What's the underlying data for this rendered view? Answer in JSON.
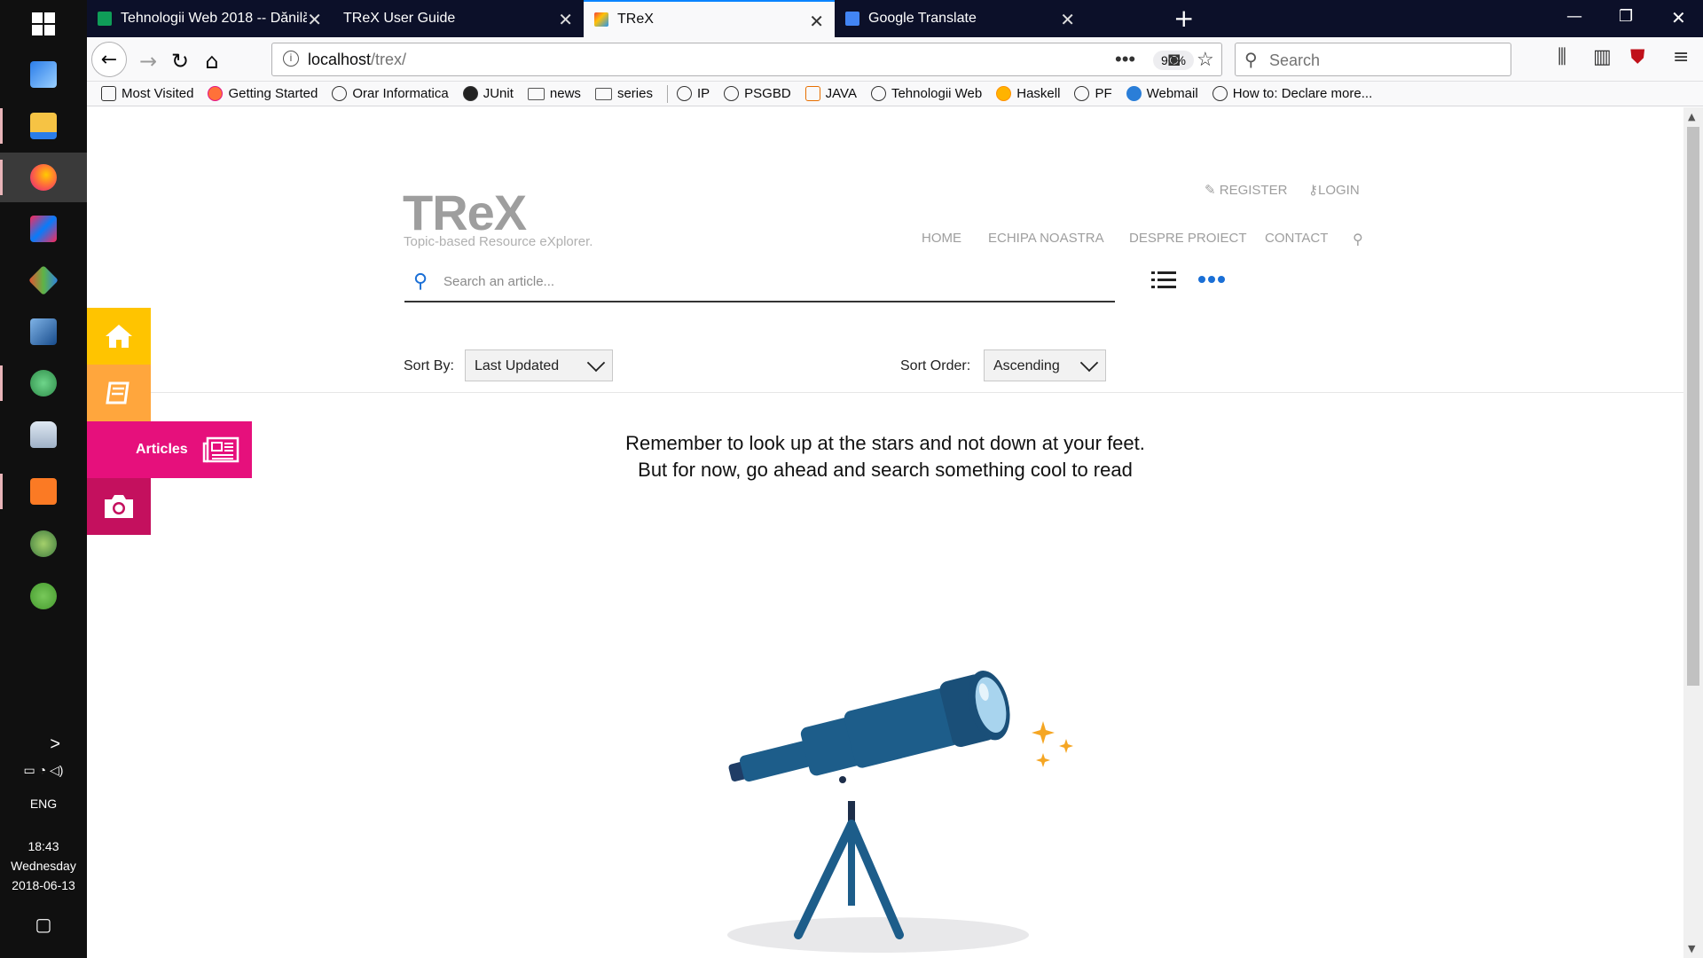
{
  "taskbar": {
    "apps": [
      "windows-start-icon",
      "network-drive-icon",
      "file-explorer-icon",
      "firefox-icon",
      "intellij-icon",
      "git-icon",
      "virtualbox-icon",
      "atom-icon",
      "database-icon",
      "xampp-icon",
      "android-studio-icon",
      "utorrent-icon"
    ],
    "expand_label": ">",
    "language": "ENG",
    "time": "18:43",
    "day": "Wednesday",
    "date": "2018-06-13"
  },
  "browser": {
    "tabs": [
      {
        "label": "Tehnologii Web 2018 -- Dănilă",
        "icon": "sheets-icon",
        "color": "#0f9d58"
      },
      {
        "label": "TReX User Guide",
        "icon": "none"
      },
      {
        "label": "TReX",
        "icon": "trex-icon",
        "active": true
      },
      {
        "label": "Google Translate",
        "icon": "translate-icon",
        "color": "#4285f4"
      }
    ],
    "new_tab": "+",
    "url_host": "localhost",
    "url_path": "/trex/",
    "zoom": "90%",
    "search_placeholder": "Search",
    "bookmarks": [
      {
        "label": "Most Visited",
        "icon": "gear-icon"
      },
      {
        "label": "Getting Started",
        "icon": "firefox-icon"
      },
      {
        "label": "Orar Informatica",
        "icon": "globe-icon"
      },
      {
        "label": "JUnit",
        "icon": "github-icon"
      },
      {
        "label": "news",
        "icon": "folder-icon"
      },
      {
        "label": "series",
        "icon": "folder-icon"
      },
      {
        "label": "IP",
        "icon": "globe-icon"
      },
      {
        "label": "PSGBD",
        "icon": "globe-icon"
      },
      {
        "label": "JAVA",
        "icon": "java-icon"
      },
      {
        "label": "Tehnologii Web",
        "icon": "globe-icon"
      },
      {
        "label": "Haskell",
        "icon": "sun-icon"
      },
      {
        "label": "PF",
        "icon": "globe-icon"
      },
      {
        "label": "Webmail",
        "icon": "webmail-icon"
      },
      {
        "label": "How to: Declare more...",
        "icon": "globe-icon"
      }
    ]
  },
  "site": {
    "logo": "TReX",
    "tagline": "Topic-based Resource eXplorer.",
    "register": "REGISTER",
    "login": "LOGIN",
    "nav": [
      "HOME",
      "ECHIPA NOASTRA",
      "DESPRE PROIECT",
      "CONTACT"
    ],
    "search_placeholder": "Search an article...",
    "sort_by_label": "Sort By:",
    "sort_by_value": "Last Updated",
    "sort_order_label": "Sort Order:",
    "sort_order_value": "Ascending",
    "quote_line1": "Remember to look up at the stars and not down at your feet.",
    "quote_line2": "But for now, go ahead and search something cool to read",
    "side_menu": {
      "articles_label": "Articles",
      "colors": {
        "home": "#ffc400",
        "books": "#ffa63d",
        "articles": "#e6107c",
        "camera": "#c4105e"
      }
    }
  }
}
